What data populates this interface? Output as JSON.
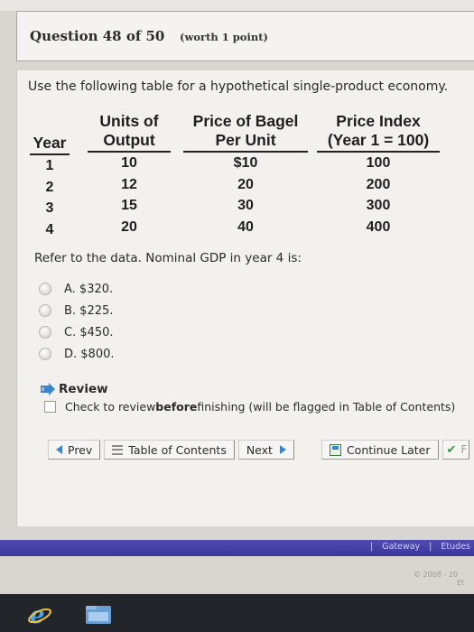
{
  "header": {
    "question_label": "Question 48 of 50",
    "worth_label": "(worth 1 point)"
  },
  "prompt": "Use the following table for a hypothetical single-product economy.",
  "table": {
    "headers": {
      "year": [
        "Year"
      ],
      "units": [
        "Units of",
        "Output"
      ],
      "price": [
        "Price of Bagel",
        "Per Unit"
      ],
      "index": [
        "Price Index",
        "(Year 1 = 100)"
      ]
    },
    "rows": [
      {
        "year": "1",
        "units": "10",
        "price": "$10",
        "index": "100"
      },
      {
        "year": "2",
        "units": "12",
        "price": "20",
        "index": "200"
      },
      {
        "year": "3",
        "units": "15",
        "price": "30",
        "index": "300"
      },
      {
        "year": "4",
        "units": "20",
        "price": "40",
        "index": "400"
      }
    ]
  },
  "question": "Refer to the data. Nominal GDP in year 4 is:",
  "options": [
    {
      "label": "A.  $320."
    },
    {
      "label": "B.  $225."
    },
    {
      "label": "C.  $450."
    },
    {
      "label": "D.  $800."
    }
  ],
  "review": {
    "title": "Review",
    "text_before": "Check to review ",
    "text_bold": "before",
    "text_after": " finishing (will be flagged in Table of Contents)"
  },
  "nav": {
    "prev": "Prev",
    "toc": "Table of Contents",
    "next": "Next",
    "continue_later": "Continue Later",
    "finish_partial": "F"
  },
  "footer": {
    "links": [
      "Gateway",
      "Etudes"
    ],
    "copyright": "© 2008 - 20",
    "copyright_line2": "Et"
  },
  "colors": {
    "accent_blue": "#3a84c9",
    "footer_bar": "#3b3699",
    "finish_check": "#2f9c3a"
  },
  "icons": [
    "prev-arrow-icon",
    "toc-icon",
    "next-arrow-icon",
    "continue-later-icon",
    "finish-check-icon",
    "flag-icon",
    "ie-icon",
    "file-explorer-icon"
  ]
}
